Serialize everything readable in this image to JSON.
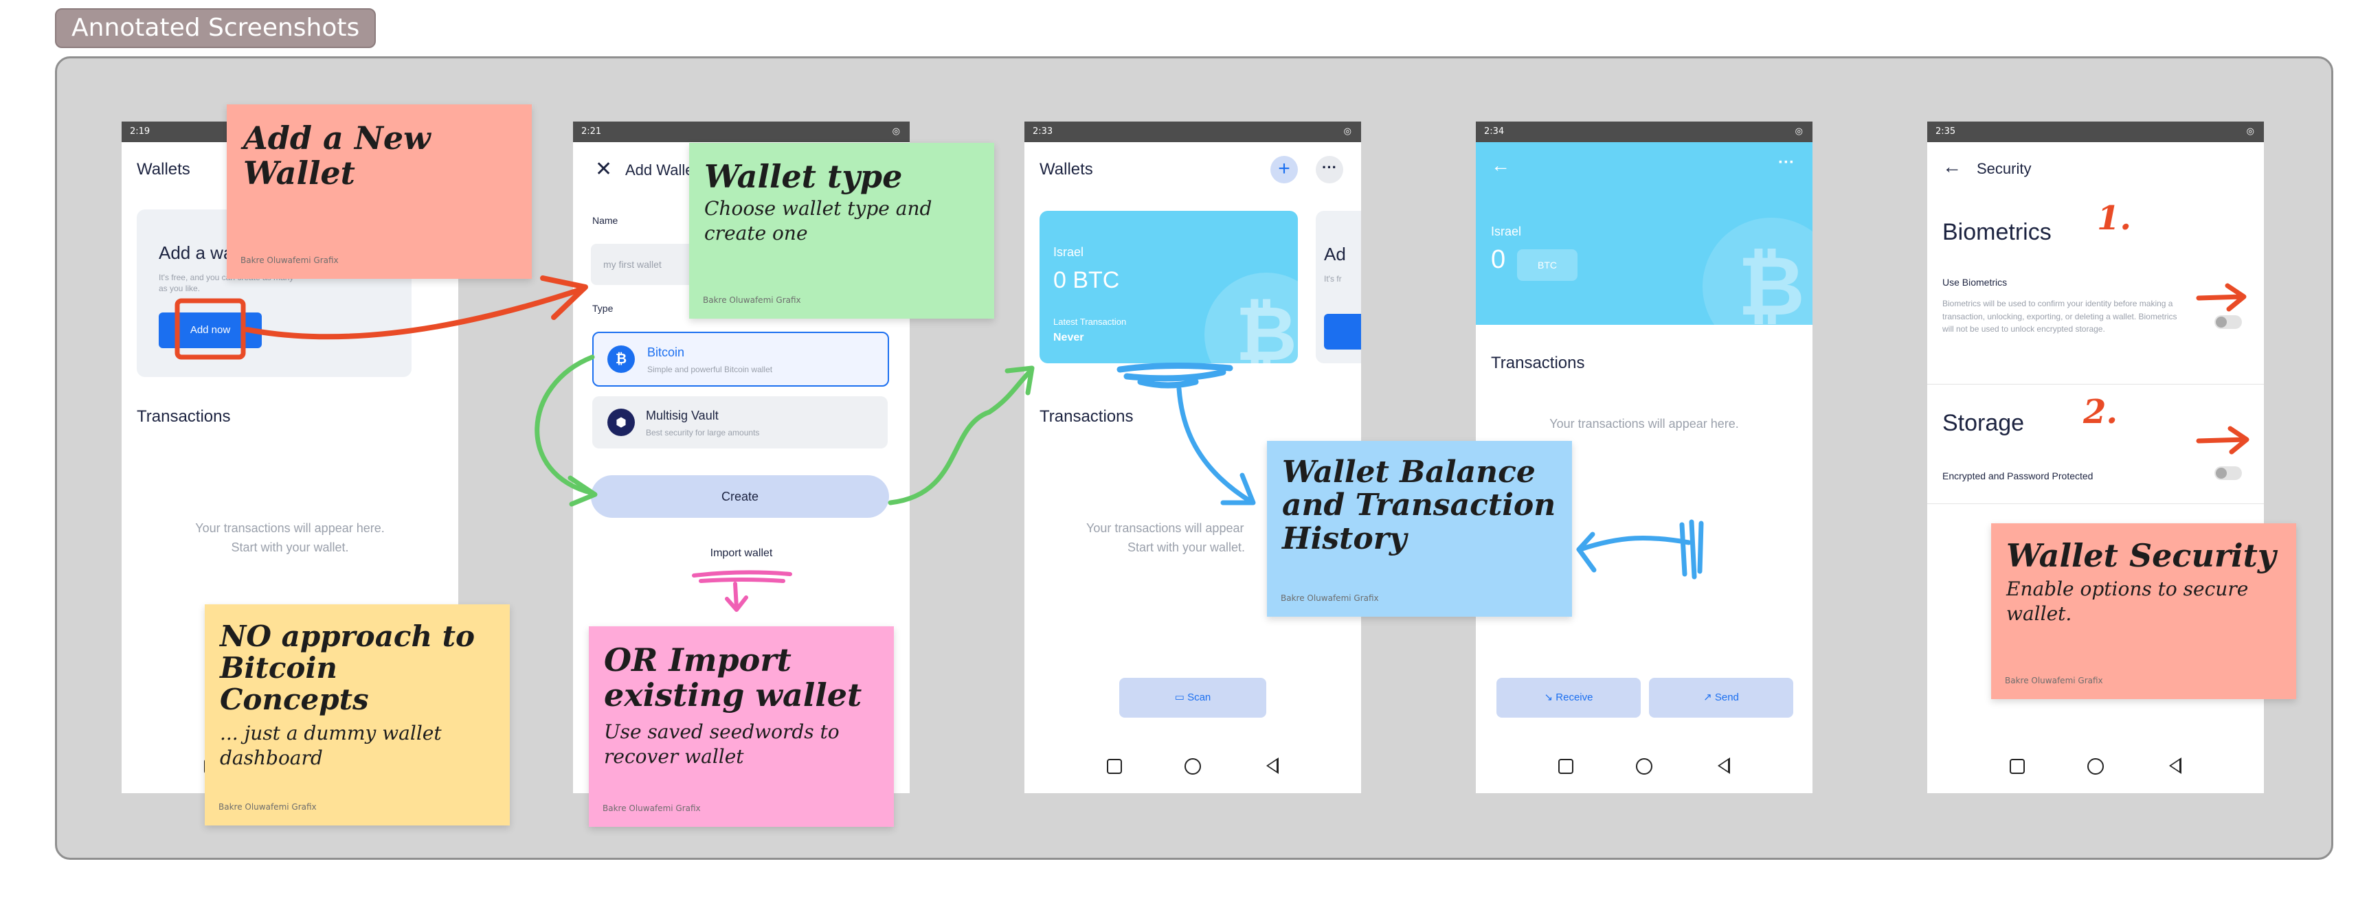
{
  "section_title": "Annotated Screenshots",
  "screen1": {
    "status_time": "2:19",
    "title": "Wallets",
    "card_title": "Add a wa",
    "card_desc": "It's free, and you can create as many as you like.",
    "add_now": "Add now",
    "transactions": "Transactions",
    "empty_line1": "Your transactions will appear here.",
    "empty_line2": "Start with your wallet."
  },
  "screen2": {
    "status_time": "2:21",
    "title": "Add Walle",
    "name_label": "Name",
    "name_placeholder": "my first wallet",
    "type_label": "Type",
    "option1_title": "Bitcoin",
    "option1_desc": "Simple and powerful Bitcoin wallet",
    "option2_title": "Multisig Vault",
    "option2_desc": "Best security for large amounts",
    "create": "Create",
    "import": "Import wallet"
  },
  "screen3": {
    "status_time": "2:33",
    "title": "Wallets",
    "card_name": "Israel",
    "card_balance": "0 BTC",
    "latest_label": "Latest Transaction",
    "latest_value": "Never",
    "peek_title": "Ad",
    "peek_desc": "It's fr",
    "transactions": "Transactions",
    "empty_line1": "Your transactions will appear",
    "empty_line2": "Start with your wallet.",
    "scan": "Scan"
  },
  "screen4": {
    "status_time": "2:34",
    "wallet_name": "Israel",
    "balance": "0",
    "unit": "BTC",
    "transactions": "Transactions",
    "empty": "Your transactions will appear here.",
    "receive": "Receive",
    "send": "Send"
  },
  "screen5": {
    "status_time": "2:35",
    "title": "Security",
    "biometrics_heading": "Biometrics",
    "use_biometrics": "Use Biometrics",
    "biometrics_desc": "Biometrics will be used to confirm your identity before making a transaction, unlocking, exporting, or deleting a wallet. Biometrics will not be used to unlock encrypted storage.",
    "storage_heading": "Storage",
    "storage_item": "Encrypted and Password Protected",
    "mark1": "1.",
    "mark2": "2."
  },
  "notes": {
    "n1_title": "Add a New Wallet",
    "n2_title": "Wallet type",
    "n2_body": "Choose wallet type and create one",
    "n3_title": "NO approach to Bitcoin Concepts",
    "n3_body": "... just a dummy wallet dashboard",
    "n4_title": "OR Import existing wallet",
    "n4_body": "Use saved seedwords to recover wallet",
    "n5_title": "Wallet Balance and Transaction History",
    "n6_title": "Wallet Security",
    "n6_body": "Enable options to secure wallet.",
    "credit": "Bakre Oluwafemi Grafix"
  },
  "colors": {
    "board": "#d4d4d4",
    "accent_blue": "#1b6ff0",
    "card_cyan": "#67d3f7",
    "note_salmon": "#ffab9d",
    "note_green": "#b3eeb8",
    "note_yellow": "#ffe196",
    "note_pink": "#ffaad9",
    "note_blue": "#a3d7fb",
    "ink_red": "#e94b26",
    "ink_green": "#62c964",
    "ink_blue": "#3fa6ef",
    "ink_pink": "#f05fb4"
  }
}
